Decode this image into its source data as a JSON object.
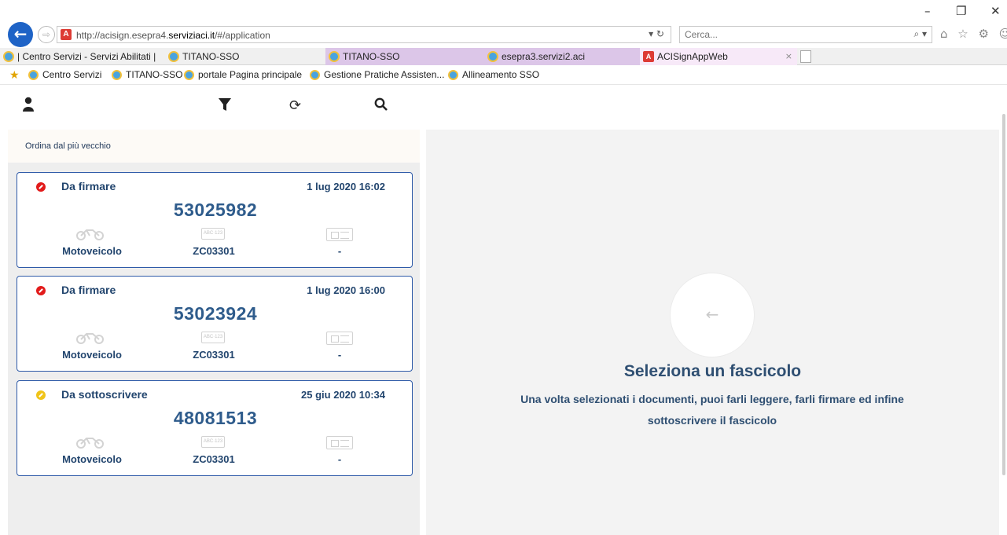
{
  "browser": {
    "url_prefix": "http://acisign.esepra4.",
    "url_domain": "serviziaci.it",
    "url_suffix": "/#/application",
    "url_tools": "▾ ↻",
    "search_placeholder": "Cerca...",
    "search_tools": "⌕ ▾",
    "win_minimize": "–",
    "win_restore": "❐",
    "win_close": "✕",
    "nav_icons": "⌂ ☆ ⚙ ☺",
    "tabs": [
      {
        "label": "| Centro Servizi - Servizi Abilitati |",
        "active": false
      },
      {
        "label": "TITANO-SSO",
        "active": false
      },
      {
        "label": "TITANO-SSO",
        "active": false
      },
      {
        "label": "esepra3.servizi2.aci",
        "active": false
      },
      {
        "label": "ACISignAppWeb",
        "active": true
      }
    ],
    "tab_close": "×",
    "favorites": [
      "Centro Servizi",
      "TITANO-SSO",
      "portale Pagina principale",
      "Gestione Pratiche Assisten...",
      "Allineamento SSO"
    ]
  },
  "app": {
    "toolbar_icons": [
      "user-icon",
      "filter-icon",
      "refresh-icon",
      "search-icon"
    ],
    "sort_label": "Ordina dal più vecchio",
    "cards": [
      {
        "status": "Da firmare",
        "status_color": "#e21b1b",
        "date": "1 lug 2020 16:02",
        "number": "53025982",
        "vehicle": "Motoveicolo",
        "plate": "ZC03301",
        "doc": "-"
      },
      {
        "status": "Da firmare",
        "status_color": "#e21b1b",
        "date": "1 lug 2020 16:00",
        "number": "53023924",
        "vehicle": "Motoveicolo",
        "plate": "ZC03301",
        "doc": "-"
      },
      {
        "status": "Da sottoscrivere",
        "status_color": "#f0c419",
        "date": "25 giu 2020 10:34",
        "number": "48081513",
        "vehicle": "Motoveicolo",
        "plate": "ZC03301",
        "doc": "-"
      }
    ],
    "plate_icon_text": "ABC·123",
    "empty_state": {
      "title": "Seleziona un fascicolo",
      "message": "Una volta selezionati i documenti, puoi farli leggere, farli firmare ed infine sottoscrivere il fascicolo",
      "arrow": "←"
    }
  },
  "colors": {
    "accent_blue": "#2e5aa8",
    "text_navy": "#22456e",
    "status_red": "#e21b1b",
    "status_yellow": "#f0c419"
  }
}
